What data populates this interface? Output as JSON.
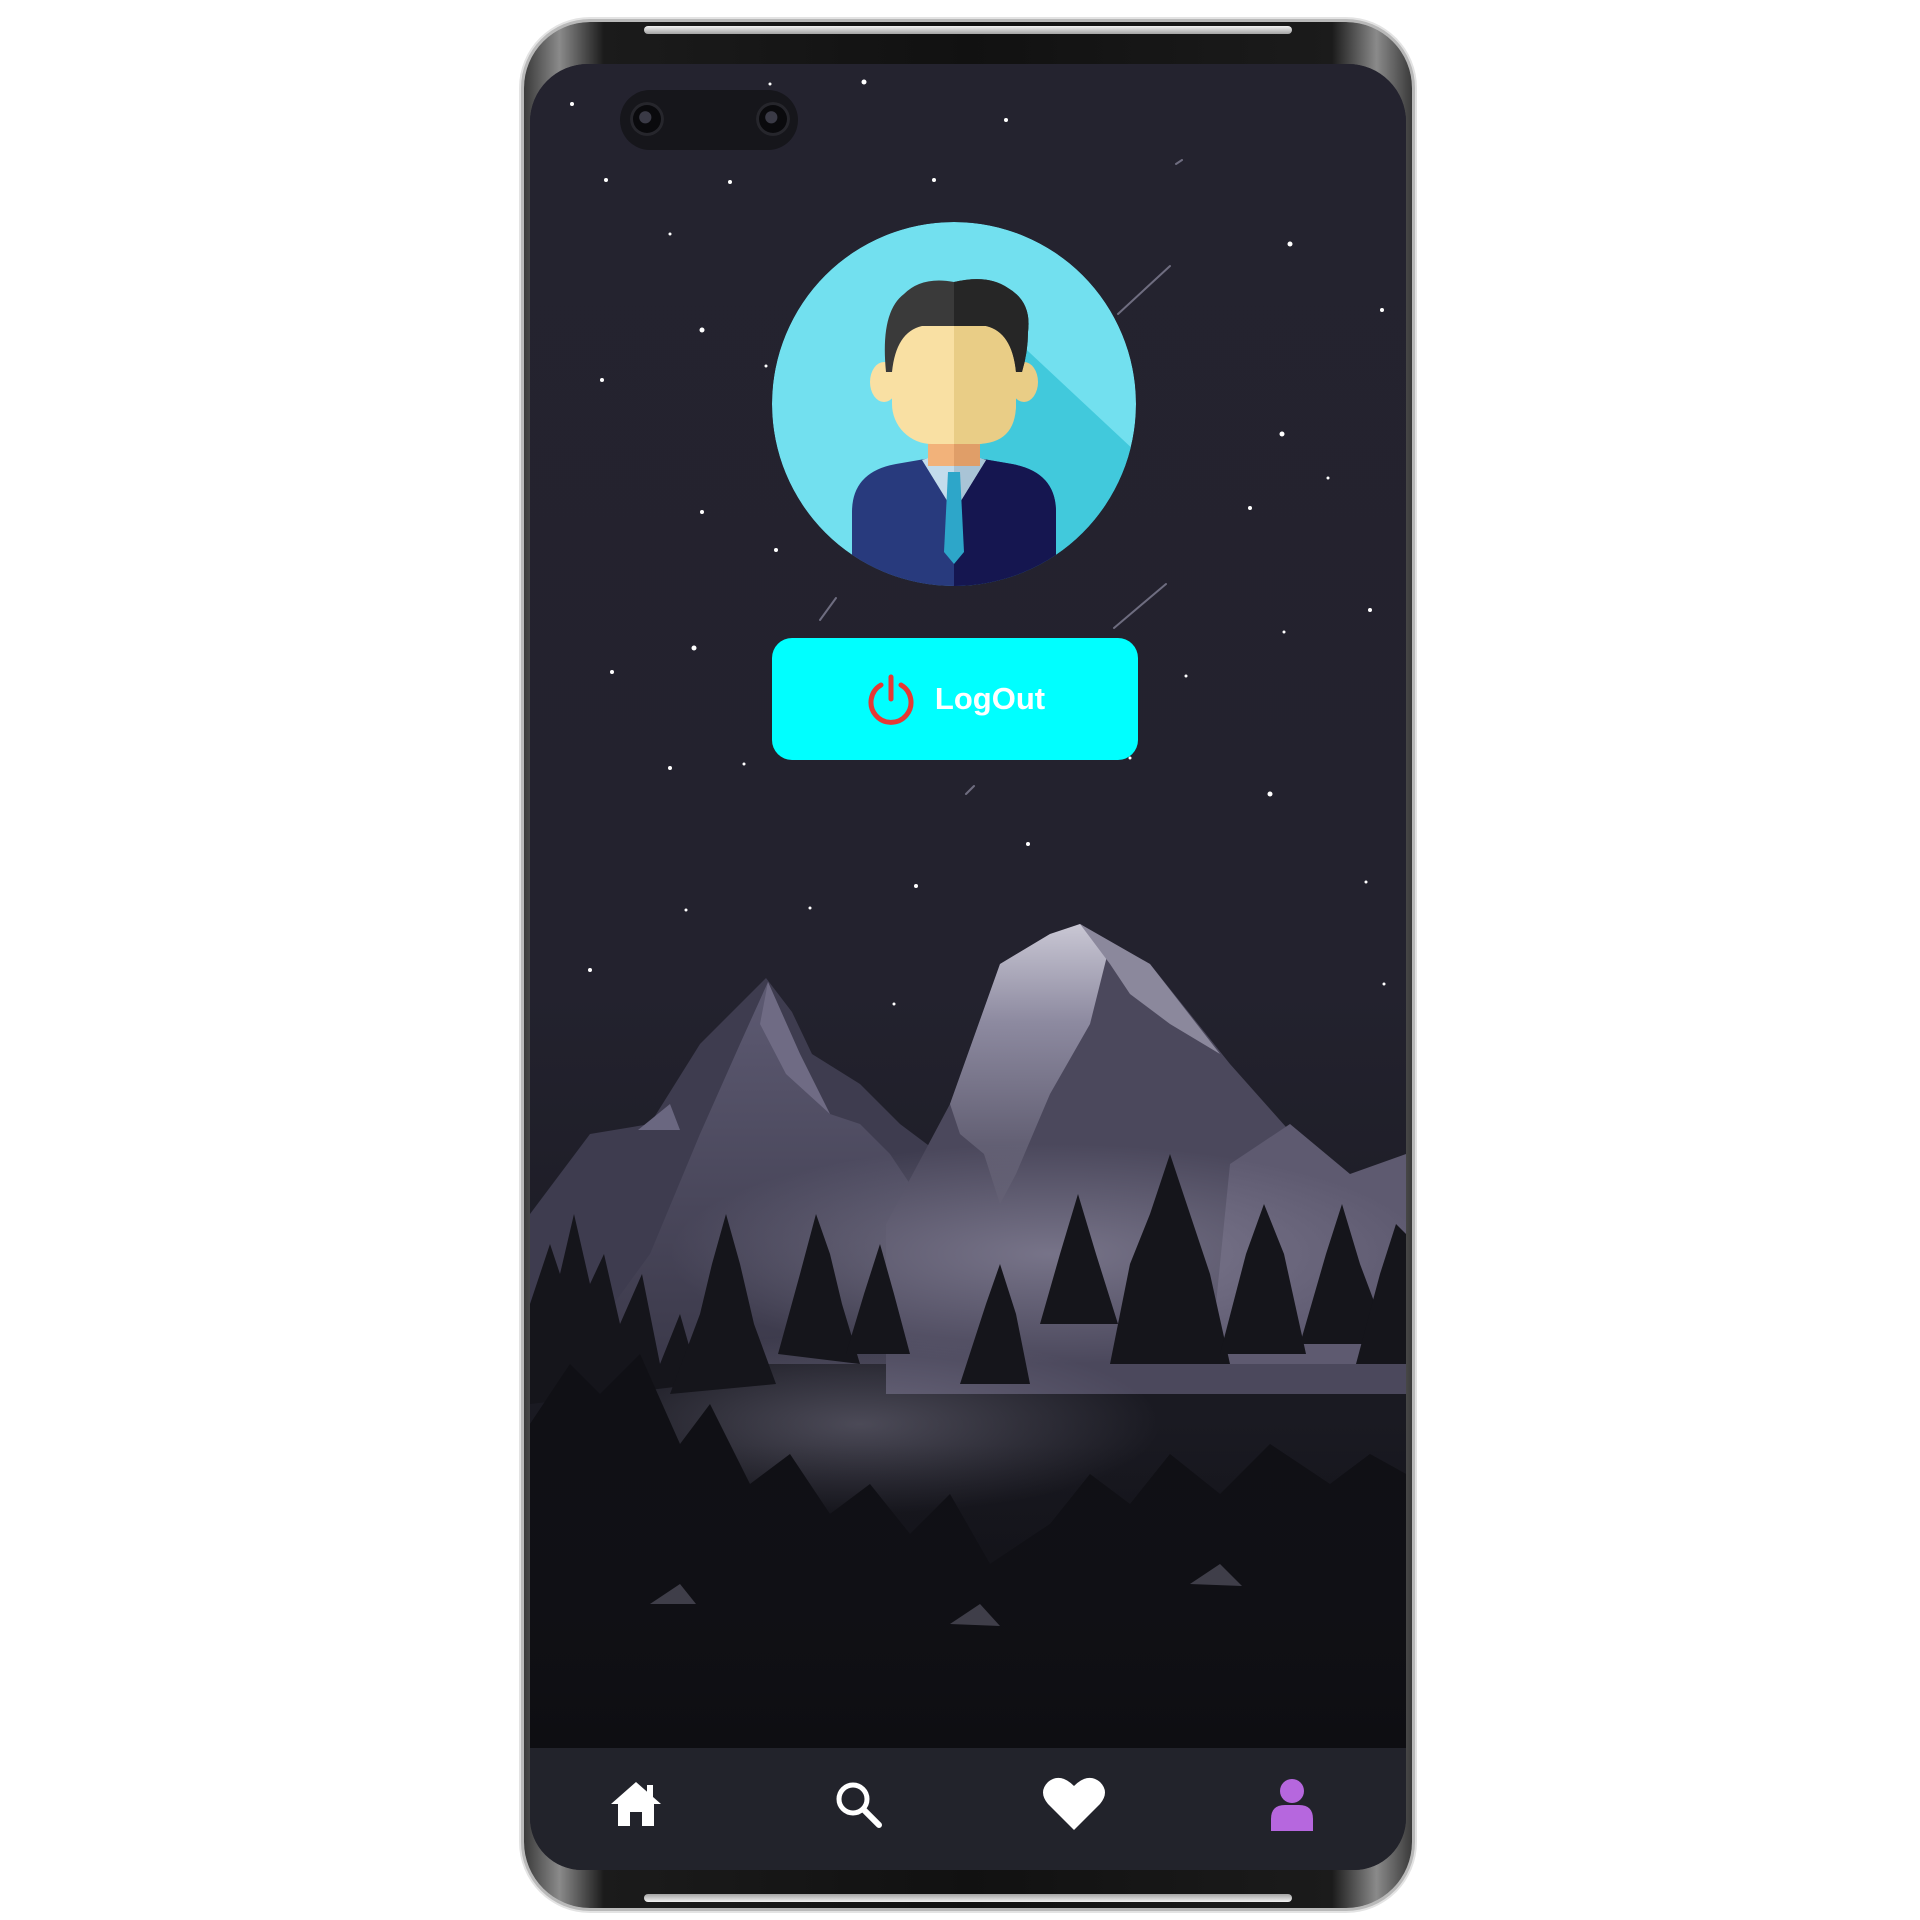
{
  "logout_button": {
    "label": "LogOut",
    "icon": "power-icon"
  },
  "profile": {
    "avatar": "user-avatar"
  },
  "bottom_nav": {
    "items": [
      {
        "name": "home",
        "icon": "home-icon",
        "active": false
      },
      {
        "name": "search",
        "icon": "search-icon",
        "active": false
      },
      {
        "name": "favorites",
        "icon": "heart-icon",
        "active": false
      },
      {
        "name": "profile",
        "icon": "person-icon",
        "active": true
      }
    ]
  },
  "colors": {
    "screen_bg": "#23222f",
    "button_bg": "#00ffff",
    "button_text": "#ffffff",
    "power_icon": "#e53935",
    "nav_bg": "#22232b",
    "nav_icon": "#ffffff",
    "nav_active": "#b667de",
    "avatar_bg": "#72e0ef"
  }
}
